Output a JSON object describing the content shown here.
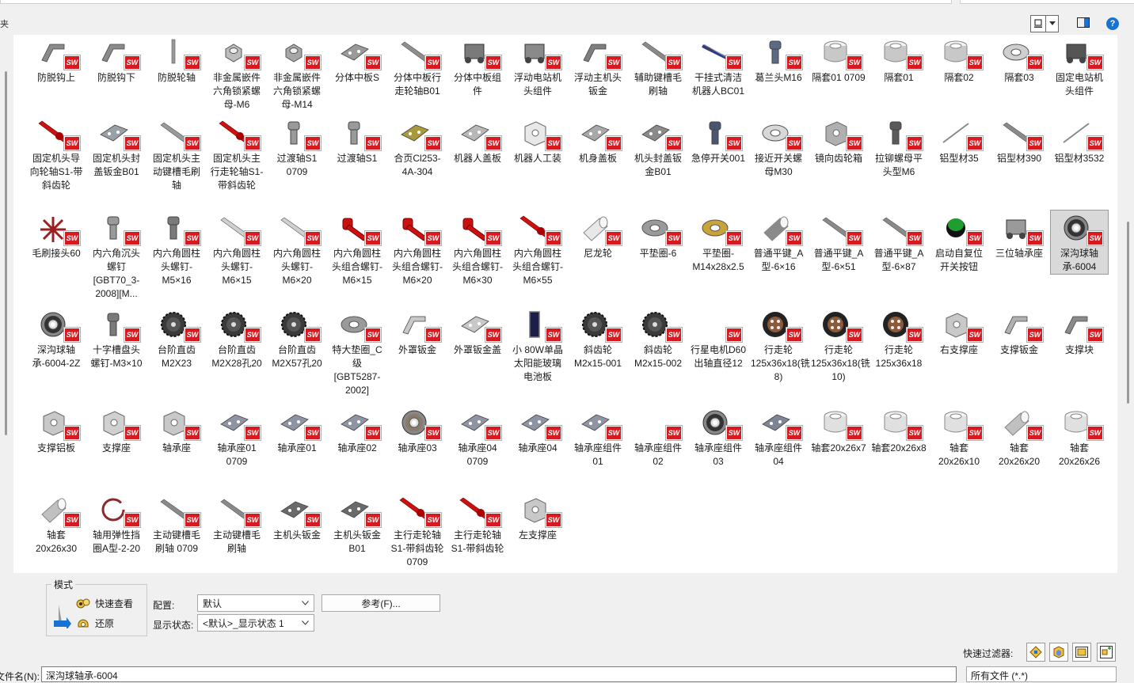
{
  "header": {
    "left_clip_label": "夹",
    "view_button_icon": "large-icons-view-icon",
    "preview_pane_icon": "preview-pane-icon",
    "help_icon": "help-icon",
    "help_glyph": "?"
  },
  "items": [
    {
      "label": "防脱钩上",
      "shape": "bracket",
      "color": "#8a8a8a"
    },
    {
      "label": "防脱钩下",
      "shape": "bracket",
      "color": "#8a8a8a"
    },
    {
      "label": "防脱轮轴",
      "shape": "rod",
      "color": "#9a9a9a"
    },
    {
      "label": "非金属嵌件六角锁紧螺母-M6",
      "shape": "nut",
      "color": "#bdbdbd"
    },
    {
      "label": "非金属嵌件六角锁紧螺母-M14",
      "shape": "nut",
      "color": "#a7a7a7"
    },
    {
      "label": "分体中板S",
      "shape": "plate",
      "color": "#9a9a9a"
    },
    {
      "label": "分体中板行走轮轴B01",
      "shape": "shaft",
      "color": "#8e8e8e"
    },
    {
      "label": "分体中板组件",
      "shape": "assembly",
      "color": "#7a7a7a"
    },
    {
      "label": "浮动电站机头组件",
      "shape": "assembly",
      "color": "#8a8a8a"
    },
    {
      "label": "浮动主机头钣金",
      "shape": "bracket",
      "color": "#7e7e7e"
    },
    {
      "label": "辅助键槽毛刷轴",
      "shape": "shaft",
      "color": "#8a8a8a"
    },
    {
      "label": "干挂式清洁机器人BC01",
      "shape": "robot",
      "color": "#2e3c8c"
    },
    {
      "label": "葛兰头M16",
      "shape": "bolt",
      "color": "#5b6b86"
    },
    {
      "label": "隔套01 0709",
      "shape": "ring",
      "color": "#c8c8c8"
    },
    {
      "label": "隔套01",
      "shape": "ring",
      "color": "#c8c8c8"
    },
    {
      "label": "隔套02",
      "shape": "ring",
      "color": "#c8c8c8"
    },
    {
      "label": "隔套03",
      "shape": "washer",
      "color": "#cfcfcf"
    },
    {
      "label": "固定电站机头组件",
      "shape": "assembly",
      "color": "#555555"
    },
    {
      "label": "固定机头导向轮轴S1-带斜齿轮",
      "shape": "redshaft",
      "color": "#cc1111"
    },
    {
      "label": "固定机头封盖钣金B01",
      "shape": "plate",
      "color": "#9aa0a8"
    },
    {
      "label": "固定机头主动键槽毛刷轴",
      "shape": "shaft",
      "color": "#9a9a9a"
    },
    {
      "label": "固定机头主行走轮轴S1-带斜齿轮",
      "shape": "redshaft",
      "color": "#cc1111"
    },
    {
      "label": "过渡轴S1 0709",
      "shape": "bolt",
      "color": "#9a9a9a"
    },
    {
      "label": "过渡轴S1",
      "shape": "bolt",
      "color": "#9a9a9a"
    },
    {
      "label": "合页Cl253-4A-304",
      "shape": "plate",
      "color": "#a89a3a"
    },
    {
      "label": "机器人盖板",
      "shape": "plate",
      "color": "#b8b8b8"
    },
    {
      "label": "机器人工装",
      "shape": "box",
      "color": "#e8e8e8"
    },
    {
      "label": "机身盖板",
      "shape": "plate",
      "color": "#a8a8a8"
    },
    {
      "label": "机头封盖钣金B01",
      "shape": "plate",
      "color": "#8a8a8a"
    },
    {
      "label": "急停开关001",
      "shape": "bolt",
      "color": "#4a5670"
    },
    {
      "label": "接近开关螺母M30",
      "shape": "washer",
      "color": "#d8d8d8"
    },
    {
      "label": "镜向齿轮箱",
      "shape": "box",
      "color": "#b0b0b0"
    },
    {
      "label": "拉铆螺母平头型M6",
      "shape": "bolt",
      "color": "#5a5a5a"
    },
    {
      "label": "铝型材35",
      "shape": "line",
      "color": "#8a8a8a"
    },
    {
      "label": "铝型材390",
      "shape": "shaft",
      "color": "#8a8a8a"
    },
    {
      "label": "铝型材3532",
      "shape": "line",
      "color": "#8a8a8a"
    },
    {
      "label": "毛刷接头60",
      "shape": "star",
      "color": "#9a2020"
    },
    {
      "label": "内六角沉头螺钉[GBT70_3-2008][M...",
      "shape": "bolt",
      "color": "#9a9a9a"
    },
    {
      "label": "内六角圆柱头螺钉-M5×16",
      "shape": "bolt",
      "color": "#7a7a7a"
    },
    {
      "label": "内六角圆柱头螺钉-M6×15",
      "shape": "shaft",
      "color": "#d0d0d0"
    },
    {
      "label": "内六角圆柱头螺钉-M6×20",
      "shape": "shaft",
      "color": "#d0d0d0"
    },
    {
      "label": "内六角圆柱头组合螺钉-M6×15",
      "shape": "redbolt",
      "color": "#cc1111"
    },
    {
      "label": "内六角圆柱头组合螺钉-M6×20",
      "shape": "redbolt",
      "color": "#cc1111"
    },
    {
      "label": "内六角圆柱头组合螺钉-M6×30",
      "shape": "redbolt",
      "color": "#cc1111"
    },
    {
      "label": "内六角圆柱头组合螺钉-M6×55",
      "shape": "redshaft",
      "color": "#cc1111"
    },
    {
      "label": "尼龙轮",
      "shape": "cylinder",
      "color": "#e8e8e8"
    },
    {
      "label": "平垫圈-6",
      "shape": "washer",
      "color": "#9a9a9a"
    },
    {
      "label": "平垫圈-M14x28x2.5",
      "shape": "washer",
      "color": "#c9a33a"
    },
    {
      "label": "普通平键_A型-6×16",
      "shape": "cylinder",
      "color": "#8a8a8a"
    },
    {
      "label": "普通平键_A型-6×51",
      "shape": "shaft",
      "color": "#8a8a8a"
    },
    {
      "label": "普通平键_A型-6×87",
      "shape": "shaft",
      "color": "#8a8a8a"
    },
    {
      "label": "启动自复位开关按钮",
      "shape": "button",
      "color": "#1e9e2e"
    },
    {
      "label": "三位轴承座",
      "shape": "assembly",
      "color": "#9a9a9a"
    },
    {
      "label": "深沟球轴承-6004",
      "shape": "bearing",
      "color": "#333333"
    },
    {
      "label": "深沟球轴承-6004-2Z",
      "shape": "bearing",
      "color": "#333333"
    },
    {
      "label": "十字槽盘头螺钉-M3×10",
      "shape": "bolt",
      "color": "#7a7a7a"
    },
    {
      "label": "台阶直齿M2X23",
      "shape": "gear",
      "color": "#3a3a3a"
    },
    {
      "label": "台阶直齿M2X28孔20",
      "shape": "gear",
      "color": "#3a3a3a"
    },
    {
      "label": "台阶直齿M2X57孔20",
      "shape": "gear",
      "color": "#3a3a3a"
    },
    {
      "label": "特大垫圈_C级[GBT5287-2002]",
      "shape": "washer",
      "color": "#9a9a9a"
    },
    {
      "label": "外罩钣金",
      "shape": "bracket",
      "color": "#c8c8c8"
    },
    {
      "label": "外罩钣金盖",
      "shape": "plate",
      "color": "#c8c8c8"
    },
    {
      "label": "小 80W单晶太阳能玻璃电池板",
      "shape": "panel",
      "color": "#1a1f4a"
    },
    {
      "label": "斜齿轮M2x15-001",
      "shape": "gear",
      "color": "#3a3a3a"
    },
    {
      "label": "斜齿轮M2x15-002",
      "shape": "gear",
      "color": "#3a3a3a"
    },
    {
      "label": "行星电机D60出轴直径12",
      "shape": "none",
      "color": "#ffffff"
    },
    {
      "label": "行走轮125x36x18(铣8)",
      "shape": "wheel",
      "color": "#222222"
    },
    {
      "label": "行走轮125x36x18(铣10)",
      "shape": "wheel",
      "color": "#222222"
    },
    {
      "label": "行走轮125x36x18",
      "shape": "wheel",
      "color": "#222222"
    },
    {
      "label": "右支撑座",
      "shape": "box",
      "color": "#c8c8c8"
    },
    {
      "label": "支撑钣金",
      "shape": "bracket",
      "color": "#b0b0b0"
    },
    {
      "label": "支撑块",
      "shape": "bracket",
      "color": "#8a8a8a"
    },
    {
      "label": "支撑铝板",
      "shape": "box",
      "color": "#c8c8c8"
    },
    {
      "label": "支撑座",
      "shape": "box",
      "color": "#d0d0d0"
    },
    {
      "label": "轴承座",
      "shape": "box",
      "color": "#c8c8c8"
    },
    {
      "label": "轴承座01 0709",
      "shape": "plate",
      "color": "#8e94a4"
    },
    {
      "label": "轴承座01",
      "shape": "plate",
      "color": "#8e94a4"
    },
    {
      "label": "轴承座02",
      "shape": "plate",
      "color": "#8e94a4"
    },
    {
      "label": "轴承座03",
      "shape": "bearing",
      "color": "#8a7a6a"
    },
    {
      "label": "轴承座04 0709",
      "shape": "plate",
      "color": "#8e94a4"
    },
    {
      "label": "轴承座04",
      "shape": "plate",
      "color": "#8e94a4"
    },
    {
      "label": "轴承座组件01",
      "shape": "plate",
      "color": "#8e94a4"
    },
    {
      "label": "轴承座组件02",
      "shape": "none",
      "color": "#ffffff"
    },
    {
      "label": "轴承座组件03",
      "shape": "bearing",
      "color": "#333333"
    },
    {
      "label": "轴承座组件04",
      "shape": "plate",
      "color": "#7e8494"
    },
    {
      "label": "轴套20x26x7",
      "shape": "ring",
      "color": "#e0e0e0"
    },
    {
      "label": "轴套20x26x8",
      "shape": "ring",
      "color": "#e0e0e0"
    },
    {
      "label": "轴套20x26x10",
      "shape": "ring",
      "color": "#e0e0e0"
    },
    {
      "label": "轴套20x26x20",
      "shape": "cylinder",
      "color": "#c0c0c0"
    },
    {
      "label": "轴套20x26x26",
      "shape": "ring",
      "color": "#e0e0e0"
    },
    {
      "label": "轴套20x26x30",
      "shape": "cylinder",
      "color": "#c0c0c0"
    },
    {
      "label": "轴用弹性挡圈A型-2-20",
      "shape": "circlip",
      "color": "#8a2a2a"
    },
    {
      "label": "主动键槽毛刷轴 0709",
      "shape": "shaft",
      "color": "#8a8a8a"
    },
    {
      "label": "主动键槽毛刷轴",
      "shape": "shaft",
      "color": "#8a8a8a"
    },
    {
      "label": "主机头钣金",
      "shape": "plate",
      "color": "#6a6a6a"
    },
    {
      "label": "主机头钣金B01",
      "shape": "plate",
      "color": "#6a6a6a"
    },
    {
      "label": "主行走轮轴S1-带斜齿轮 0709",
      "shape": "redshaft",
      "color": "#cc1111"
    },
    {
      "label": "主行走轮轴S1-带斜齿轮",
      "shape": "redshaft",
      "color": "#cc1111"
    },
    {
      "label": "左支撑座",
      "shape": "box",
      "color": "#c8c8c8"
    }
  ],
  "selected_label": "深沟球轴承-6004",
  "badge_text": "SW",
  "options": {
    "mode_legend": "模式",
    "quick_view_label": "快速查看",
    "restore_label": "还原",
    "config_label": "配置:",
    "config_value": "默认",
    "display_state_label": "显示状态:",
    "display_state_value": "<默认>_显示状态 1",
    "reference_button": "参考(F)..."
  },
  "footer": {
    "quick_filter_label": "快速过滤器:",
    "file_name_label": "文件名(N):",
    "file_name_value": "深沟球轴承-6004",
    "file_type_value": "所有文件 (*.*)"
  }
}
